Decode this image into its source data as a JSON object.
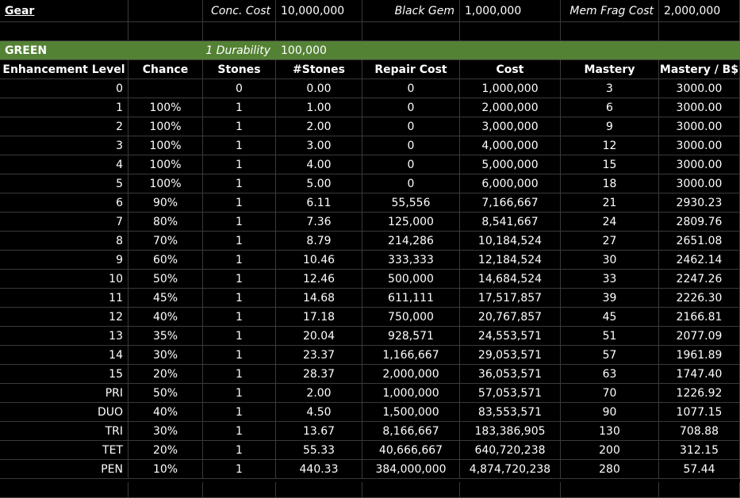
{
  "top": {
    "gear_label": "Gear",
    "conc_label": "Conc. Cost",
    "conc_value": "10,000,000",
    "black_gem_label": "Black Gem",
    "black_gem_value": "1,000,000",
    "mem_frag_label": "Mem Frag Cost",
    "mem_frag_value": "2,000,000"
  },
  "section": {
    "name": "GREEN",
    "durability_label": "1 Durability",
    "durability_value": "100,000"
  },
  "columns": [
    "Enhancement Level",
    "Chance",
    "Stones",
    "#Stones",
    "Repair Cost",
    "Cost",
    "Mastery",
    "Mastery / B$"
  ],
  "rows": [
    [
      "0",
      "",
      "0",
      "0.00",
      "0",
      "1,000,000",
      "3",
      "3000.00"
    ],
    [
      "1",
      "100%",
      "1",
      "1.00",
      "0",
      "2,000,000",
      "6",
      "3000.00"
    ],
    [
      "2",
      "100%",
      "1",
      "2.00",
      "0",
      "3,000,000",
      "9",
      "3000.00"
    ],
    [
      "3",
      "100%",
      "1",
      "3.00",
      "0",
      "4,000,000",
      "12",
      "3000.00"
    ],
    [
      "4",
      "100%",
      "1",
      "4.00",
      "0",
      "5,000,000",
      "15",
      "3000.00"
    ],
    [
      "5",
      "100%",
      "1",
      "5.00",
      "0",
      "6,000,000",
      "18",
      "3000.00"
    ],
    [
      "6",
      "90%",
      "1",
      "6.11",
      "55,556",
      "7,166,667",
      "21",
      "2930.23"
    ],
    [
      "7",
      "80%",
      "1",
      "7.36",
      "125,000",
      "8,541,667",
      "24",
      "2809.76"
    ],
    [
      "8",
      "70%",
      "1",
      "8.79",
      "214,286",
      "10,184,524",
      "27",
      "2651.08"
    ],
    [
      "9",
      "60%",
      "1",
      "10.46",
      "333,333",
      "12,184,524",
      "30",
      "2462.14"
    ],
    [
      "10",
      "50%",
      "1",
      "12.46",
      "500,000",
      "14,684,524",
      "33",
      "2247.26"
    ],
    [
      "11",
      "45%",
      "1",
      "14.68",
      "611,111",
      "17,517,857",
      "39",
      "2226.30"
    ],
    [
      "12",
      "40%",
      "1",
      "17.18",
      "750,000",
      "20,767,857",
      "45",
      "2166.81"
    ],
    [
      "13",
      "35%",
      "1",
      "20.04",
      "928,571",
      "24,553,571",
      "51",
      "2077.09"
    ],
    [
      "14",
      "30%",
      "1",
      "23.37",
      "1,166,667",
      "29,053,571",
      "57",
      "1961.89"
    ],
    [
      "15",
      "20%",
      "1",
      "28.37",
      "2,000,000",
      "36,053,571",
      "63",
      "1747.40"
    ],
    [
      "PRI",
      "50%",
      "1",
      "2.00",
      "1,000,000",
      "57,053,571",
      "70",
      "1226.92"
    ],
    [
      "DUO",
      "40%",
      "1",
      "4.50",
      "1,500,000",
      "83,553,571",
      "90",
      "1077.15"
    ],
    [
      "TRI",
      "30%",
      "1",
      "13.67",
      "8,166,667",
      "183,386,905",
      "130",
      "708.88"
    ],
    [
      "TET",
      "20%",
      "1",
      "55.33",
      "40,666,667",
      "640,720,238",
      "200",
      "312.15"
    ],
    [
      "PEN",
      "10%",
      "1",
      "440.33",
      "384,000,000",
      "4,874,720,238",
      "280",
      "57.44"
    ]
  ],
  "colors": {
    "section_bg": "#548235",
    "grid_line": "#3a3a3a",
    "background": "#000000"
  }
}
